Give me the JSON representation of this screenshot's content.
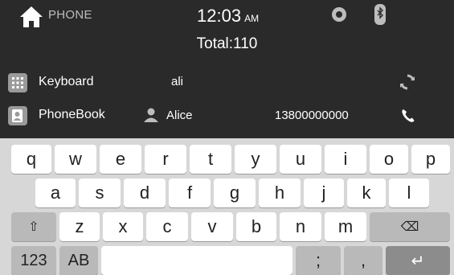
{
  "status": {
    "app_title": "PHONE",
    "time": "12:03",
    "ampm": "AM"
  },
  "total_text": "Total:110",
  "rows": {
    "keyboard": {
      "label": "Keyboard",
      "search_text": "ali"
    },
    "phonebook": {
      "label": "PhoneBook",
      "contact_name": "Alice",
      "contact_number": "13800000000"
    }
  },
  "keyboard": {
    "row1": [
      "q",
      "w",
      "e",
      "r",
      "t",
      "y",
      "u",
      "i",
      "o",
      "p"
    ],
    "row2": [
      "a",
      "s",
      "d",
      "f",
      "g",
      "h",
      "j",
      "k",
      "l"
    ],
    "row3": [
      "z",
      "x",
      "c",
      "v",
      "b",
      "n",
      "m"
    ],
    "shift": "⇧",
    "backspace": "⌫",
    "numbers": "123",
    "layout_toggle": "AB",
    "semicolon": ";",
    "comma": ",",
    "enter": "↵"
  },
  "icons": {
    "home": "home-icon",
    "disc": "disc-icon",
    "bluetooth": "bluetooth-icon",
    "keypad": "keypad-icon",
    "phonebook": "phonebook-icon",
    "person": "person-icon",
    "refresh": "refresh-icon",
    "call": "call-icon"
  }
}
